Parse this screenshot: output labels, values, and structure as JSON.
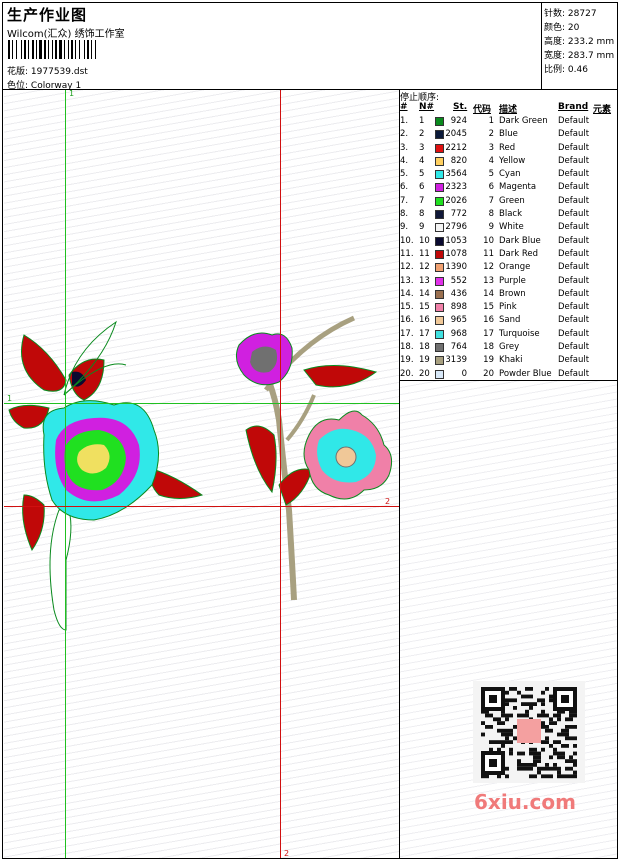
{
  "header": {
    "title": "生产作业图",
    "company": "Wilcom(汇众) 绣饰工作室",
    "design_label": "花版:",
    "design_value": "1977539.dst",
    "colorway_label": "色位:",
    "colorway_value": "Colorway 1"
  },
  "stats": {
    "stitches_label": "针数:",
    "stitches_value": "28727",
    "colors_label": "颜色:",
    "colors_value": "20",
    "height_label": "高度:",
    "height_value": "233.2 mm",
    "width_label": "宽度:",
    "width_value": "283.7 mm",
    "scale_label": "比例:",
    "scale_value": "0.46"
  },
  "sequence": {
    "title": "停止顺序:",
    "headers": {
      "hash": "#",
      "num": "N#",
      "st": "St.",
      "code": "代码",
      "desc": "描述",
      "brand": "Brand",
      "element": "元素"
    },
    "rows": [
      {
        "i": "1.",
        "n": "1",
        "c": "#0a8a1e",
        "st": "924",
        "code": "1",
        "desc": "Dark Green",
        "brand": "Default"
      },
      {
        "i": "2.",
        "n": "2",
        "c": "#0b1a3a",
        "st": "2045",
        "code": "2",
        "desc": "Blue",
        "brand": "Default"
      },
      {
        "i": "3.",
        "n": "3",
        "c": "#e01010",
        "st": "2212",
        "code": "3",
        "desc": "Red",
        "brand": "Default"
      },
      {
        "i": "4.",
        "n": "4",
        "c": "#ffd060",
        "st": "820",
        "code": "4",
        "desc": "Yellow",
        "brand": "Default"
      },
      {
        "i": "5.",
        "n": "5",
        "c": "#30e8e8",
        "st": "3564",
        "code": "5",
        "desc": "Cyan",
        "brand": "Default"
      },
      {
        "i": "6.",
        "n": "6",
        "c": "#d020e0",
        "st": "2323",
        "code": "6",
        "desc": "Magenta",
        "brand": "Default"
      },
      {
        "i": "7.",
        "n": "7",
        "c": "#20e020",
        "st": "2026",
        "code": "7",
        "desc": "Green",
        "brand": "Default"
      },
      {
        "i": "8.",
        "n": "8",
        "c": "#101838",
        "st": "772",
        "code": "8",
        "desc": "Black",
        "brand": "Default"
      },
      {
        "i": "9.",
        "n": "9",
        "c": "#f4f4f4",
        "st": "2796",
        "code": "9",
        "desc": "White",
        "brand": "Default"
      },
      {
        "i": "10.",
        "n": "10",
        "c": "#0a0a30",
        "st": "1053",
        "code": "10",
        "desc": "Dark Blue",
        "brand": "Default"
      },
      {
        "i": "11.",
        "n": "11",
        "c": "#c00808",
        "st": "1078",
        "code": "11",
        "desc": "Dark Red",
        "brand": "Default"
      },
      {
        "i": "12.",
        "n": "12",
        "c": "#f0a070",
        "st": "1390",
        "code": "12",
        "desc": "Orange",
        "brand": "Default"
      },
      {
        "i": "13.",
        "n": "13",
        "c": "#e030e8",
        "st": "552",
        "code": "13",
        "desc": "Purple",
        "brand": "Default"
      },
      {
        "i": "14.",
        "n": "14",
        "c": "#9a7050",
        "st": "436",
        "code": "14",
        "desc": "Brown",
        "brand": "Default"
      },
      {
        "i": "15.",
        "n": "15",
        "c": "#f080a8",
        "st": "898",
        "code": "15",
        "desc": "Pink",
        "brand": "Default"
      },
      {
        "i": "16.",
        "n": "16",
        "c": "#f0c898",
        "st": "965",
        "code": "16",
        "desc": "Sand",
        "brand": "Default"
      },
      {
        "i": "17.",
        "n": "17",
        "c": "#40e0e0",
        "st": "968",
        "code": "17",
        "desc": "Turquoise",
        "brand": "Default"
      },
      {
        "i": "18.",
        "n": "18",
        "c": "#707070",
        "st": "764",
        "code": "18",
        "desc": "Grey",
        "brand": "Default"
      },
      {
        "i": "19.",
        "n": "19",
        "c": "#a8a080",
        "st": "3139",
        "code": "19",
        "desc": "Khaki",
        "brand": "Default"
      },
      {
        "i": "20.",
        "n": "20",
        "c": "#d8e8f8",
        "st": "0",
        "code": "20",
        "desc": "Powder Blue",
        "brand": "Default"
      }
    ]
  },
  "guides": {
    "v1": "1",
    "h1": "1",
    "h2": "2",
    "v2": "2"
  },
  "watermark": {
    "site": "6xiu.com"
  }
}
